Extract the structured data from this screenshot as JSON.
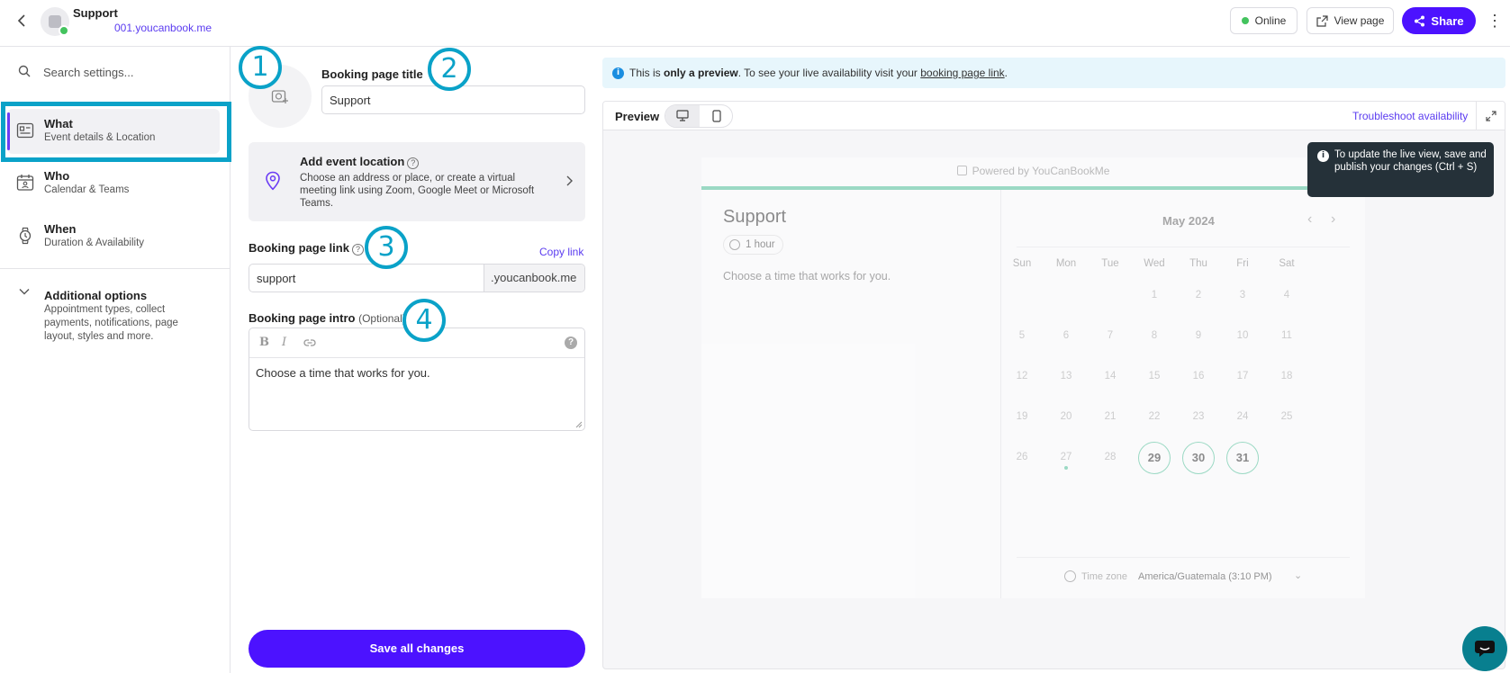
{
  "header": {
    "title": "Support",
    "subdomain": "001.youcanbook.me",
    "online_label": "Online",
    "view_page_label": "View page",
    "share_label": "Share"
  },
  "sidebar": {
    "search_placeholder": "Search settings...",
    "items": [
      {
        "label": "What",
        "sub": "Event details & Location"
      },
      {
        "label": "Who",
        "sub": "Calendar & Teams"
      },
      {
        "label": "When",
        "sub": "Duration & Availability"
      }
    ],
    "additional": {
      "title": "Additional options",
      "desc": "Appointment types, collect payments, notifications, page layout, styles and more."
    }
  },
  "form": {
    "title_label": "Booking page title",
    "title_value": "Support",
    "location": {
      "title": "Add event location",
      "desc": "Choose an address or place, or create a virtual meeting link using Zoom, Google Meet or Microsoft Teams."
    },
    "link_label": "Booking page link",
    "copy_link": "Copy link",
    "link_value": "support",
    "link_suffix": ".youcanbook.me",
    "intro_label": "Booking page intro",
    "intro_optional": "(Optional)",
    "intro_value": "Choose a time that works for you.",
    "save_label": "Save all changes"
  },
  "callouts": [
    "1",
    "2",
    "3",
    "4"
  ],
  "preview": {
    "banner_pre": "This is ",
    "banner_bold": "only a preview",
    "banner_mid": ". To see your live availability visit your ",
    "banner_link": "booking page link",
    "banner_end": ".",
    "label": "Preview",
    "troubleshoot": "Troubleshoot availability",
    "tooltip": "To update the live view, save and publish your changes (Ctrl + S)",
    "card": {
      "powered_by": "Powered by YouCanBookMe",
      "title": "Support",
      "duration": "1 hour",
      "intro": "Choose a time that works for you.",
      "month": "May 2024",
      "weekdays": [
        "Sun",
        "Mon",
        "Tue",
        "Wed",
        "Thu",
        "Fri",
        "Sat"
      ],
      "weeks": [
        [
          "",
          "",
          "",
          "1",
          "2",
          "3",
          "4"
        ],
        [
          "5",
          "6",
          "7",
          "8",
          "9",
          "10",
          "11"
        ],
        [
          "12",
          "13",
          "14",
          "15",
          "16",
          "17",
          "18"
        ],
        [
          "19",
          "20",
          "21",
          "22",
          "23",
          "24",
          "25"
        ],
        [
          "26",
          "27",
          "28",
          "29",
          "30",
          "31",
          ""
        ]
      ],
      "available_days": [
        "29",
        "30",
        "31"
      ],
      "today": "27",
      "timezone_label": "Time zone",
      "timezone_value": "America/Guatemala (3:10 PM)"
    }
  },
  "colors": {
    "accent": "#4c12ff",
    "highlight": "#0aa2c8",
    "online": "#43c35e",
    "calendar_accent": "#52c29a",
    "tooltip_bg": "#253139"
  }
}
